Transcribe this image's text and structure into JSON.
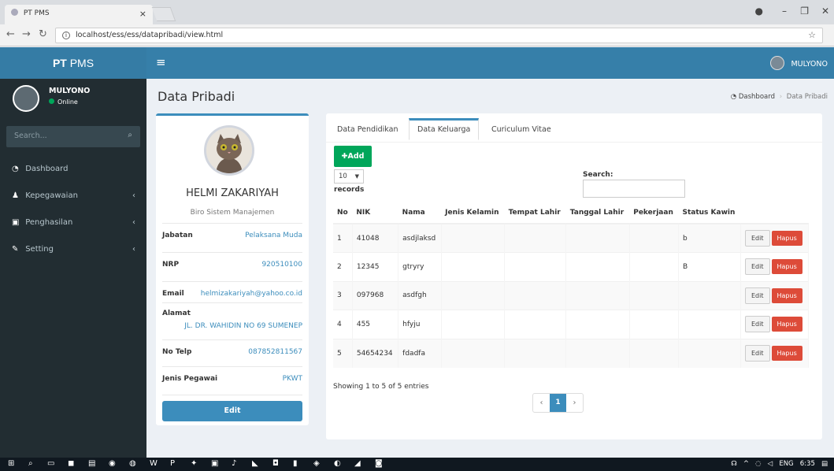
{
  "browser": {
    "tab_title": "PT PMS",
    "url": "localhost/ess/ess/datapribadi/view.html"
  },
  "header": {
    "logo_bold": "PT",
    "logo_rest": " PMS",
    "user_name": "MULYONO"
  },
  "sidebar": {
    "user_name": "MULYONO",
    "user_status": "Online",
    "search_placeholder": "Search...",
    "items": [
      {
        "label": "Dashboard",
        "icon": "dashboard-icon",
        "has_chevron": false
      },
      {
        "label": "Kepegawaian",
        "icon": "user-icon",
        "has_chevron": true
      },
      {
        "label": "Penghasilan",
        "icon": "money-icon",
        "has_chevron": true
      },
      {
        "label": "Setting",
        "icon": "wrench-icon",
        "has_chevron": true
      }
    ]
  },
  "page": {
    "title": "Data Pribadi",
    "breadcrumb": [
      "Dashboard",
      "Data Pribadi"
    ]
  },
  "profile": {
    "name": "HELMI ZAKARIYAH",
    "department": "Biro Sistem Manajemen",
    "fields": [
      {
        "label": "Jabatan",
        "value": "Pelaksana Muda"
      },
      {
        "label": "NRP",
        "value": "920510100"
      },
      {
        "label": "Email",
        "value": "helmizakariyah@yahoo.co.id"
      },
      {
        "label": "Alamat",
        "value": "JL. DR. WAHIDIN NO 69 SUMENEP"
      },
      {
        "label": "No Telp",
        "value": "087852811567"
      },
      {
        "label": "Jenis Pegawai",
        "value": "PKWT"
      }
    ],
    "edit_label": "Edit"
  },
  "main": {
    "tabs": [
      {
        "label": "Data Pendidikan",
        "active": false
      },
      {
        "label": "Data Keluarga",
        "active": true
      },
      {
        "label": "Curiculum Vitae",
        "active": false
      }
    ],
    "add_label": "Add",
    "page_length": "10",
    "records_label": "records",
    "search_label": "Search:",
    "search_value": "",
    "columns": [
      "No",
      "NIK",
      "Nama",
      "Jenis Kelamin",
      "Tempat Lahir",
      "Tanggal Lahir",
      "Pekerjaan",
      "Status Kawin",
      ""
    ],
    "rows": [
      {
        "no": "1",
        "nik": "41048",
        "nama": "asdjlaksd",
        "jenis_kelamin": "",
        "tempat_lahir": "",
        "tanggal_lahir": "",
        "pekerjaan": "",
        "status_kawin": "b"
      },
      {
        "no": "2",
        "nik": "12345",
        "nama": "gtryry",
        "jenis_kelamin": "",
        "tempat_lahir": "",
        "tanggal_lahir": "",
        "pekerjaan": "",
        "status_kawin": "B"
      },
      {
        "no": "3",
        "nik": "097968",
        "nama": "asdfgh",
        "jenis_kelamin": "",
        "tempat_lahir": "",
        "tanggal_lahir": "",
        "pekerjaan": "",
        "status_kawin": ""
      },
      {
        "no": "4",
        "nik": "455",
        "nama": "hfyju",
        "jenis_kelamin": "",
        "tempat_lahir": "",
        "tanggal_lahir": "",
        "pekerjaan": "",
        "status_kawin": ""
      },
      {
        "no": "5",
        "nik": "54654234",
        "nama": "fdadfa",
        "jenis_kelamin": "",
        "tempat_lahir": "",
        "tanggal_lahir": "",
        "pekerjaan": "",
        "status_kawin": ""
      }
    ],
    "edit_label": "Edit",
    "delete_label": "Hapus",
    "info": "Showing 1 to 5 of 5 entries",
    "current_page": "1"
  },
  "taskbar": {
    "language": "ENG",
    "time": "6:35"
  },
  "colors": {
    "header": "#367fa9",
    "sidebar": "#222d32",
    "primary": "#3c8dbc",
    "success": "#00a65a",
    "danger": "#dd4b39"
  }
}
